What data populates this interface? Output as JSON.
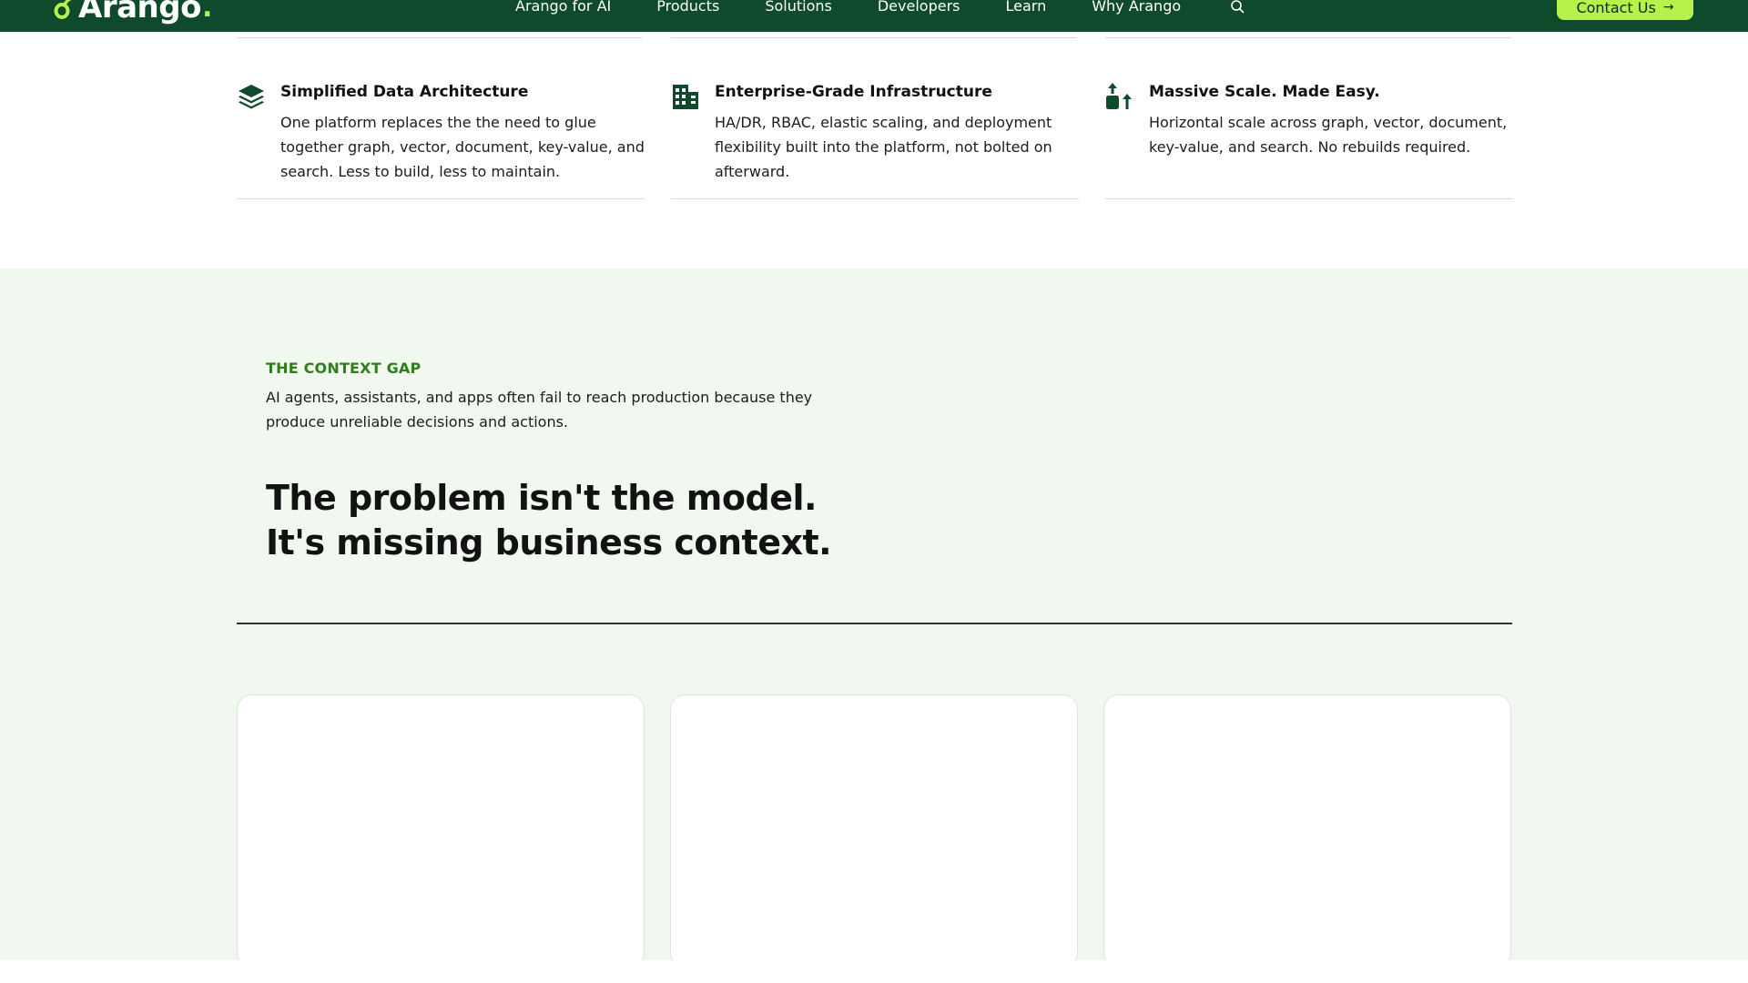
{
  "nav": {
    "logo_text": "Arango",
    "logo_dot": ".",
    "links": [
      "Arango for AI",
      "Products",
      "Solutions",
      "Developers",
      "Learn",
      "Why Arango"
    ],
    "search_icon": "search-icon",
    "contact_label": "Contact Us",
    "contact_arrow": "→",
    "background_color": "#0f4a2c",
    "accent_color": "#b7f24b"
  },
  "features": [
    {
      "icon": "layers-icon",
      "title": "Simplified Data Architecture",
      "description": "One platform replaces the the need to glue together graph, vector, document, key-value, and search. Less to build, less to maintain."
    },
    {
      "icon": "building-icon",
      "title": "Enterprise-Grade Infrastructure",
      "description": "HA/DR, RBAC, elastic scaling, and deployment flexibility built into the platform, not bolted on afterward."
    },
    {
      "icon": "scale-up-icon",
      "title": "Massive Scale. Made Easy.",
      "description": "Horizontal scale across graph, vector, document, key-value, and search. No rebuilds required."
    }
  ],
  "context_gap": {
    "eyebrow": "THE CONTEXT GAP",
    "intro": "AI agents, assistants, and apps often fail to reach production because they produce unreliable decisions and actions.",
    "headline_line1": "The problem isn't the model.",
    "headline_line2": "It's missing business context.",
    "section_color": "#f0f8f0",
    "eyebrow_color": "#2f7d1b"
  }
}
